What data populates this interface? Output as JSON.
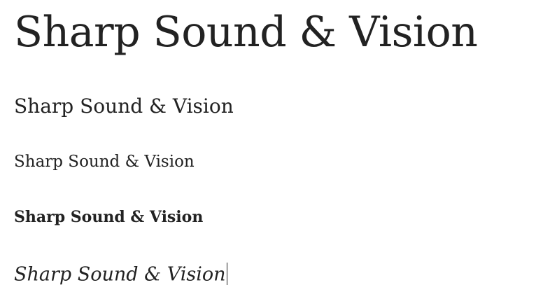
{
  "samples": [
    {
      "text": "Sharp Sound & Vision",
      "style": "heading"
    },
    {
      "text": "Sharp Sound & Vision",
      "style": "large"
    },
    {
      "text": "Sharp Sound & Vision",
      "style": "regular"
    },
    {
      "text": "Sharp Sound & Vision",
      "style": "bold"
    },
    {
      "text": "Sharp Sound & Vision",
      "style": "italic"
    }
  ],
  "colors": {
    "text": "#222222",
    "background": "#ffffff"
  }
}
